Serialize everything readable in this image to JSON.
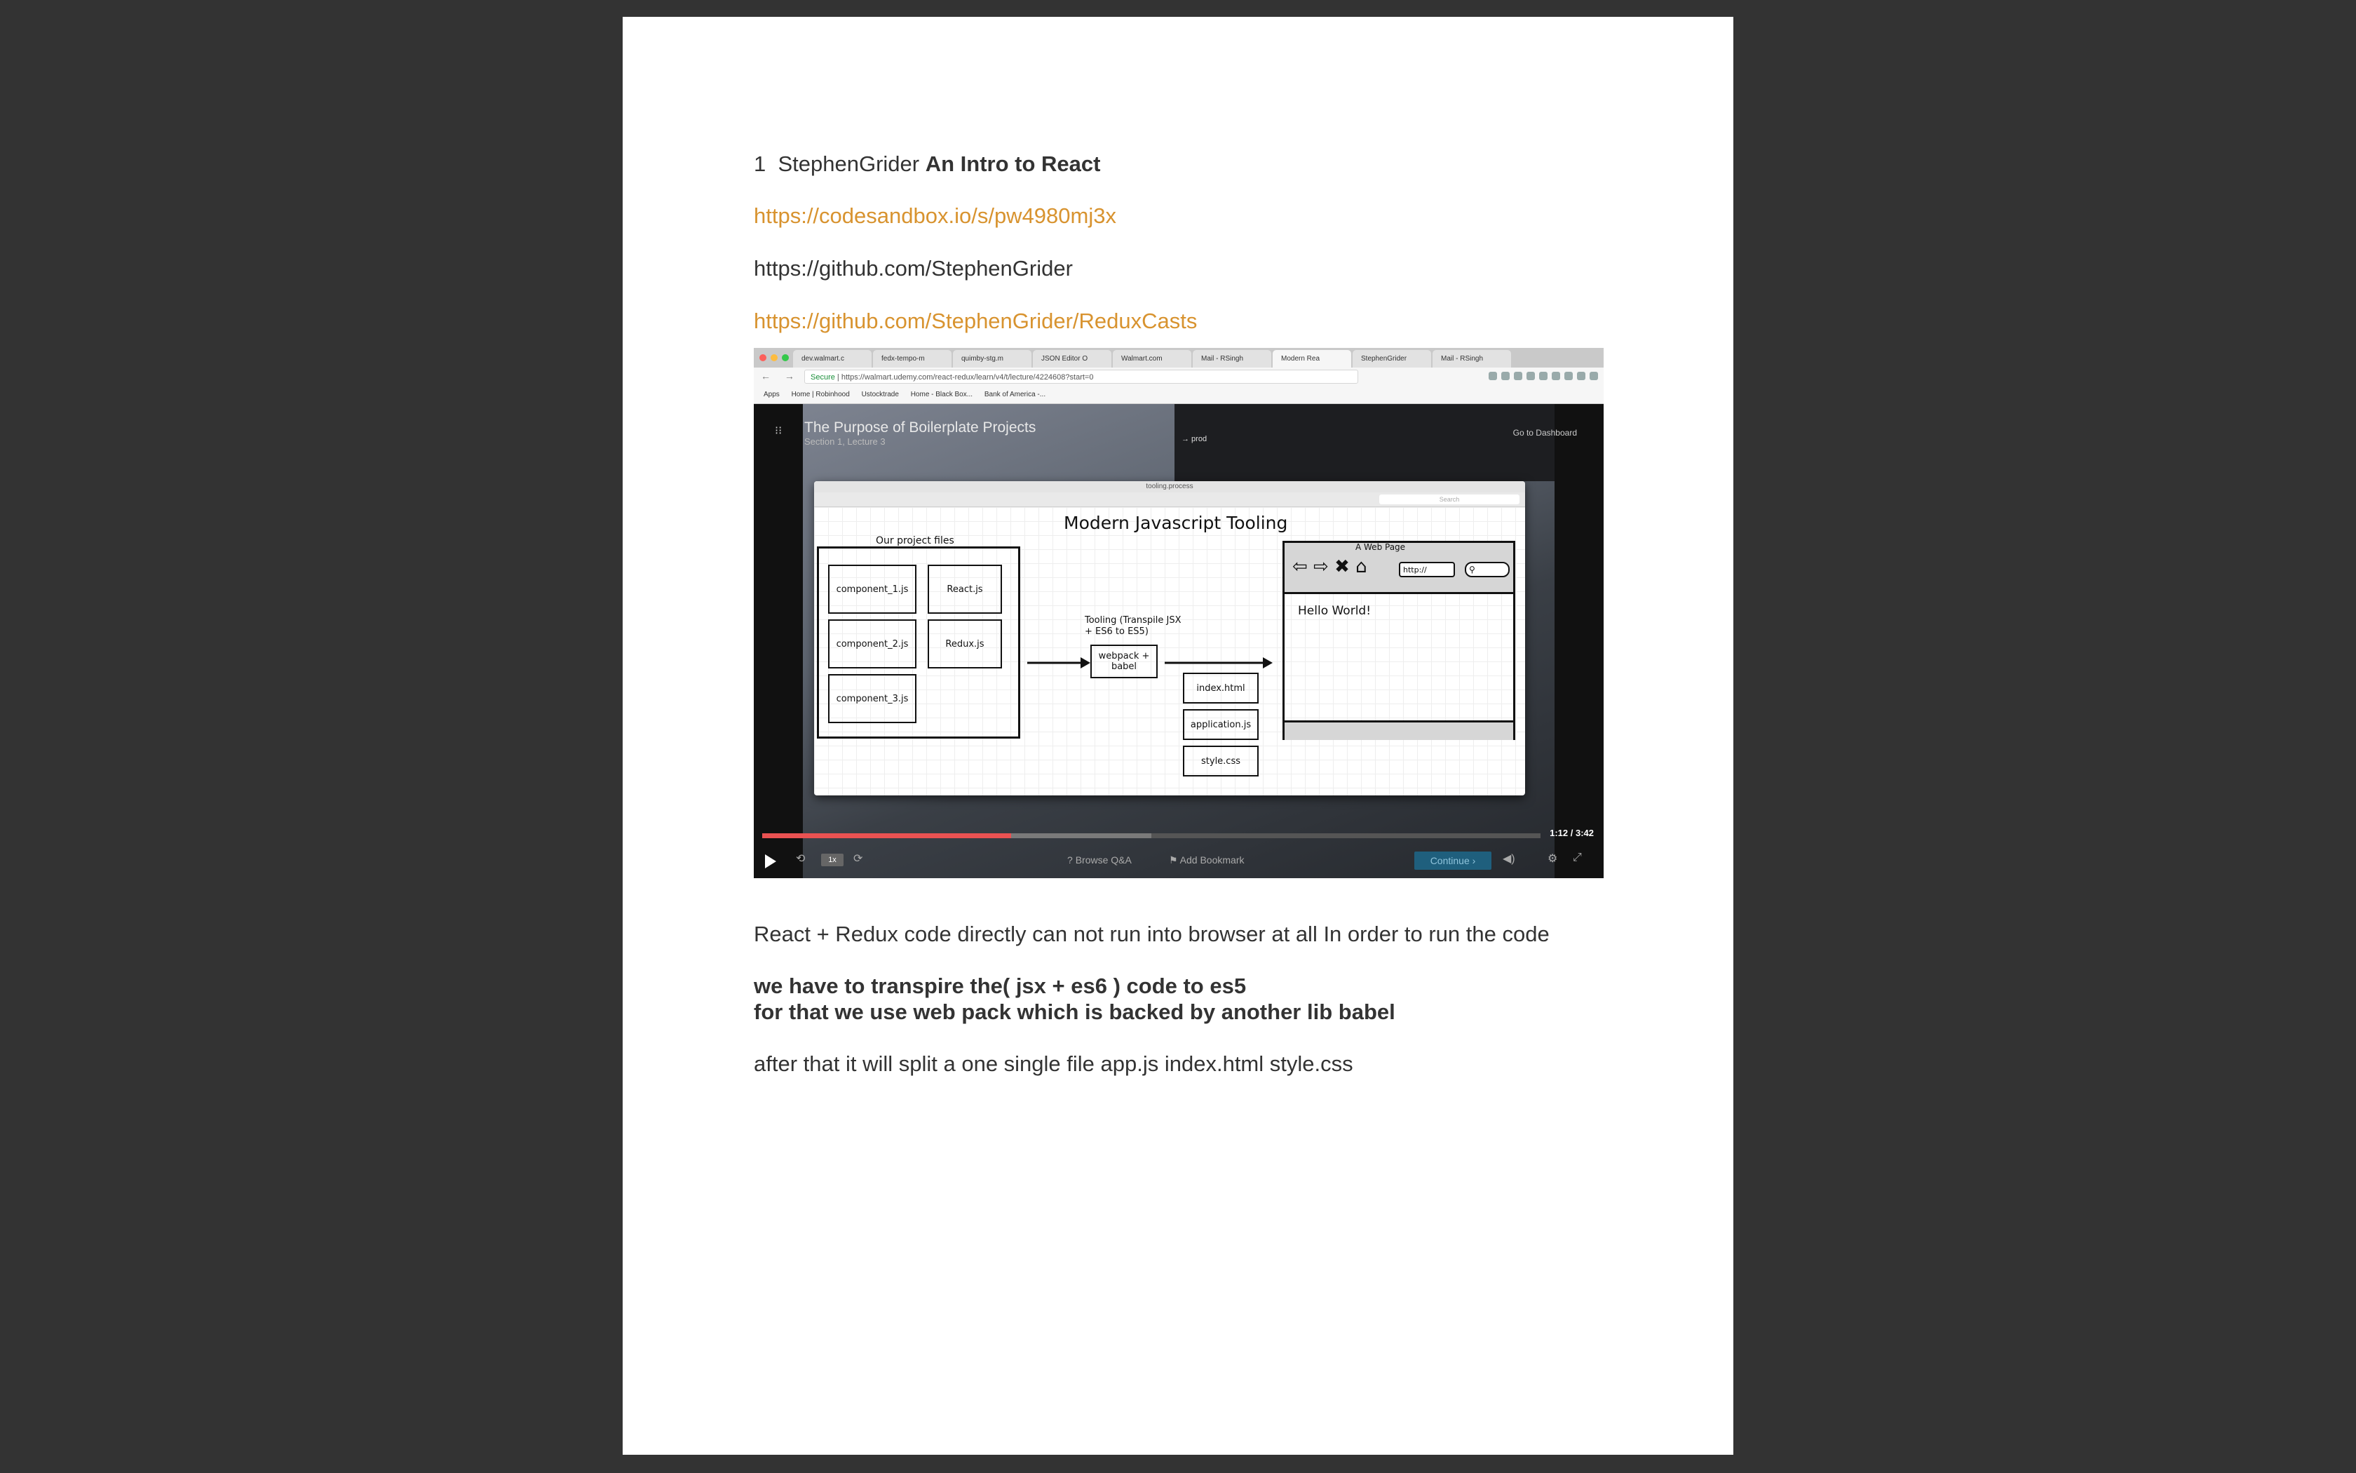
{
  "document": {
    "heading": {
      "number": "1",
      "author": "StephenGrider",
      "title": "An Intro to React"
    },
    "links": [
      "https://codesandbox.io/s/pw4980mj3x",
      "https://github.com/StephenGrider",
      "https://github.com/StephenGrider/ReduxCasts"
    ],
    "paragraph1": "React + Redux code directly can not run into browser at all In order to run the code",
    "bold_line1": "we have to transpire the( jsx + es6 ) code  to es5",
    "bold_line2": "for that we use web pack which is backed by another lib babel",
    "paragraph3": "after that it will split a one single file app.js index.html style.css"
  },
  "screenshot": {
    "tabs": [
      "dev.walmart.c",
      "fedx-tempo-m",
      "quimby-stg.m",
      "JSON Editor O",
      "Walmart.com",
      "Mail - RSingh",
      "Modern Rea",
      "StephenGrider",
      "Mail - RSingh"
    ],
    "address": {
      "secure_label": "Secure",
      "url": "https://walmart.udemy.com/react-redux/learn/v4/t/lecture/4224608?start=0"
    },
    "bookmarks": [
      "Apps",
      "Home | Robinhood",
      "Ustocktrade",
      "Home - Black Box...",
      "Bank of America -..."
    ],
    "player": {
      "lecture_title": "The Purpose of Boilerplate Projects",
      "lecture_sub": "Section 1, Lecture 3",
      "go_dashboard": "Go to Dashboard",
      "terminal_text": "→ prod",
      "window_title": "tooling.process",
      "search_placeholder": "Search",
      "slide": {
        "title": "Modern Javascript Tooling",
        "project_files_label": "Our project files",
        "files_left": [
          "component_1.js",
          "component_2.js",
          "component_3.js"
        ],
        "files_right": [
          "React.js",
          "Redux.js"
        ],
        "tooling_label": "Tooling (Transpile JSX + ES6 to ES5)",
        "tooling_box": "webpack + babel",
        "outputs": [
          "index.html",
          "application.js",
          "style.css"
        ],
        "webpage_label": "A Web Page",
        "url_field": "http://",
        "hello": "Hello World!"
      },
      "time_current": "1:12",
      "time_total": "3:42",
      "progress": 0.32,
      "buffered": 0.5,
      "speed": "1x",
      "browse_qa": "Browse Q&A",
      "add_bookmark": "Add Bookmark",
      "continue_label": "Continue"
    }
  }
}
